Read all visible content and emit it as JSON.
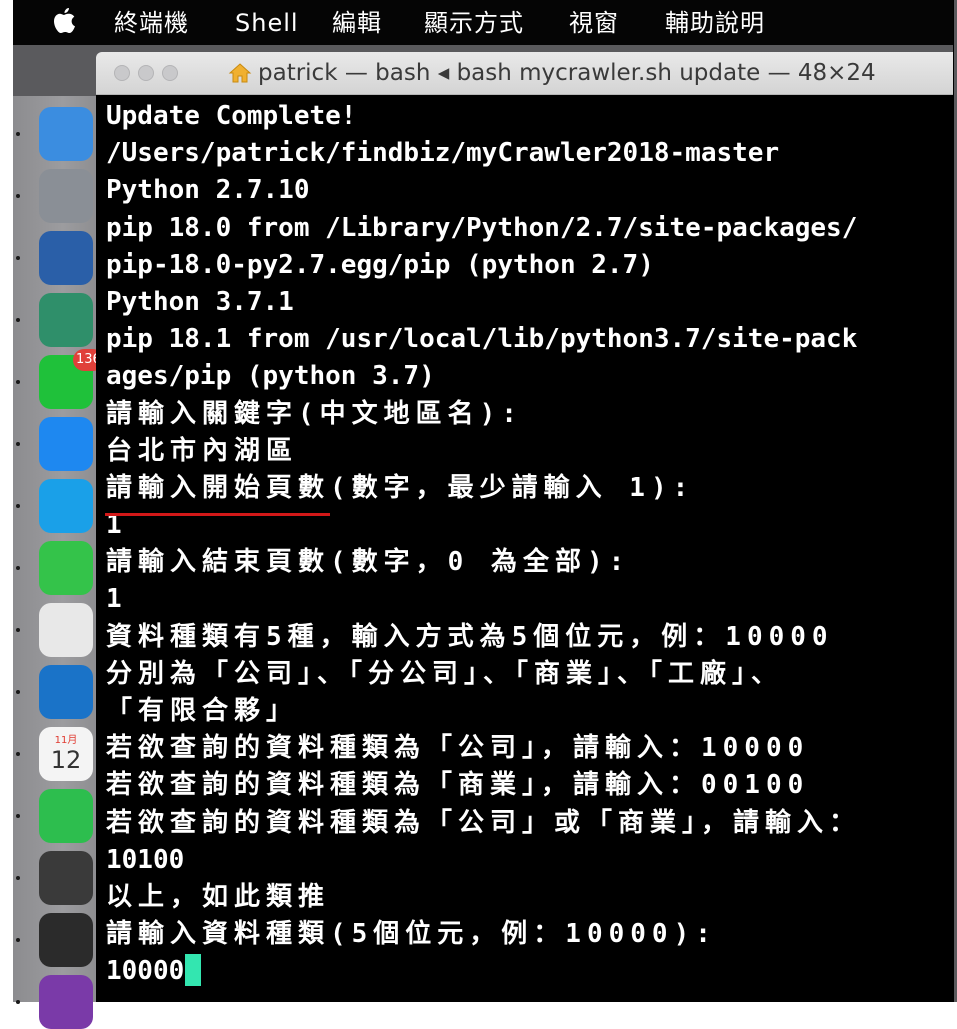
{
  "menubar": {
    "items": [
      "終端機",
      "Shell",
      "編輯",
      "顯示方式",
      "視窗",
      "輔助說明"
    ]
  },
  "window": {
    "title": "patrick — bash ◂ bash mycrawler.sh update — 48×24"
  },
  "terminal": {
    "lines": [
      "Update Complete!",
      "/Users/patrick/findbiz/myCrawler2018-master",
      "Python 2.7.10",
      "pip 18.0 from /Library/Python/2.7/site-packages/",
      "pip-18.0-py2.7.egg/pip (python 2.7)",
      "Python 3.7.1",
      "pip 18.1 from /usr/local/lib/python3.7/site-pack",
      "ages/pip (python 3.7)",
      "請輸入關鍵字(中文地區名):",
      "台北市內湖區",
      "請輸入開始頁數(數字，最少請輸入 1):",
      "1",
      "請輸入結束頁數(數字，0 為全部):",
      "1",
      "資料種類有5種，輸入方式為5個位元，例：10000",
      "分別為「公司」、「分公司」、「商業」、「工廠」、",
      "「有限合夥」",
      "若欲查詢的資料種類為「公司」，請輸入：10000",
      "若欲查詢的資料種類為「商業」，請輸入：00100",
      "若欲查詢的資料種類為「公司」或「商業」，請輸入：",
      "10100",
      "以上，如此類推",
      "請輸入資料種類(5個位元，例：10000):",
      "10000"
    ]
  },
  "dock": {
    "items": [
      {
        "name": "finder-icon",
        "color": "#3b8de0"
      },
      {
        "name": "launchpad-icon",
        "color": "#8a8f96"
      },
      {
        "name": "mission-control-icon",
        "color": "#2a5fa8"
      },
      {
        "name": "photos-icon",
        "color": "#2f8f6a"
      },
      {
        "name": "line-icon",
        "color": "#1fc13a",
        "badge": "136"
      },
      {
        "name": "messenger-icon",
        "color": "#1e88f0"
      },
      {
        "name": "skype-icon",
        "color": "#1aa0e8"
      },
      {
        "name": "wechat-icon",
        "color": "#34c34a"
      },
      {
        "name": "slack-icon",
        "color": "#e8e8e8"
      },
      {
        "name": "trello-icon",
        "color": "#1a73c8"
      },
      {
        "name": "calendar-icon",
        "color": "#f4f4f4",
        "month": "11月",
        "day": "12"
      },
      {
        "name": "evernote-icon",
        "color": "#2dbe4e"
      },
      {
        "name": "sublime-text-icon",
        "color": "#3a3a3a"
      },
      {
        "name": "terminal-icon",
        "color": "#2b2b2b"
      },
      {
        "name": "purple-app-icon",
        "color": "#7a3aa8"
      }
    ]
  },
  "colors": {
    "cursor": "#33e6b0",
    "underline": "#d21818",
    "terminal_bg": "#000000",
    "terminal_fg": "#ffffff"
  }
}
